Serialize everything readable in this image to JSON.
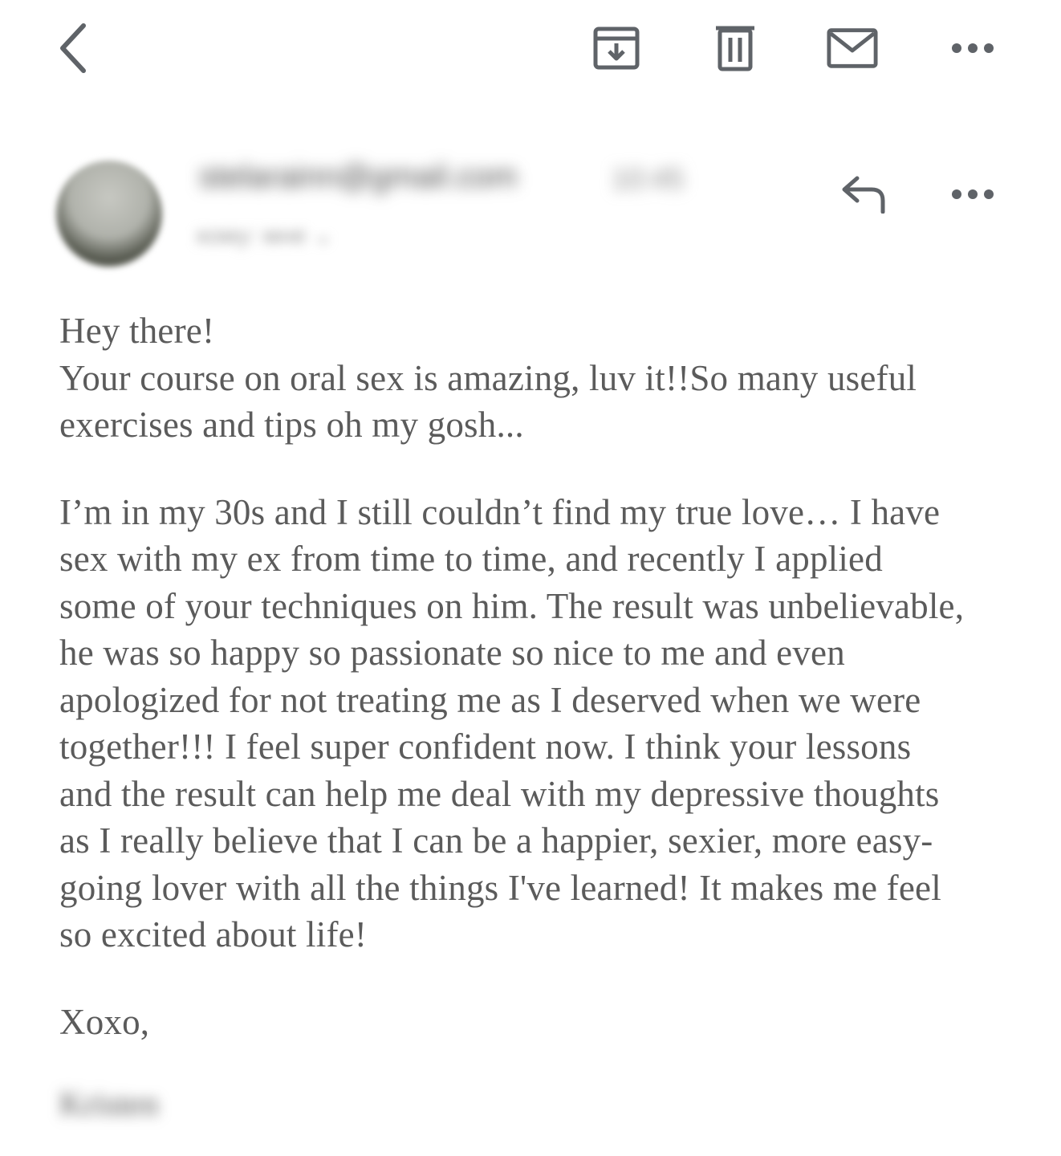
{
  "toolbar": {
    "back": "back-icon",
    "archive": "archive-icon",
    "delete": "trash-icon",
    "mark_unread": "envelope-icon",
    "more": "more-horizontal-icon"
  },
  "message": {
    "sender_email": "stelarainn@gmail.com",
    "time": "10:45",
    "recipient_line": "кому: мне ⌄",
    "reply": "reply-icon",
    "more": "more-horizontal-icon",
    "greeting": "Hey there!\nYour course on oral sex is amazing, luv it!!So many useful\nexercises and tips oh my gosh...",
    "main": "I’m in my 30s and I still couldn’t find my true love… I have\nsex with my ex from time to time, and recently I applied\nsome of your techniques on him. The result was unbelievable,\nhe was so happy so passionate so nice to me and even\napologized for not treating me as I deserved when we were\ntogether!!!  I feel super confident now. I think your lessons\nand the result can help me deal with my depressive thoughts\nas I really believe that I can be a happier, sexier, more easy-\ngoing lover with all the things I've learned! It makes me feel\nso excited about life!",
    "signoff": "Xoxo,",
    "signature": "Kristen"
  },
  "colors": {
    "icon": "#5f6368",
    "text": "#5b5b5b",
    "background": "#ffffff"
  }
}
